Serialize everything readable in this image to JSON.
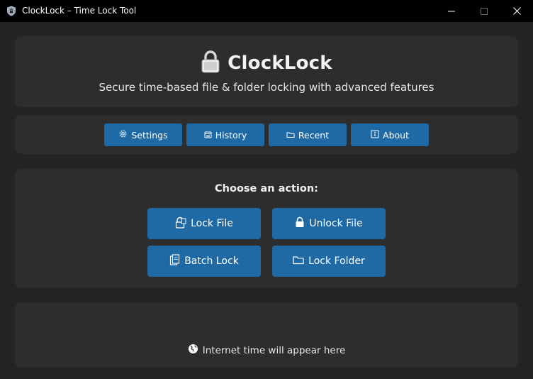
{
  "window": {
    "title": "ClockLock – Time Lock Tool",
    "icon": "shield-lock-icon"
  },
  "header": {
    "app_name": "ClockLock",
    "tagline": "Secure time-based file & folder locking with advanced features",
    "icon": "padlock-icon"
  },
  "nav": {
    "settings": {
      "label": "Settings",
      "icon": "gear-icon"
    },
    "history": {
      "label": "History",
      "icon": "history-icon"
    },
    "recent": {
      "label": "Recent",
      "icon": "folder-icon"
    },
    "about": {
      "label": "About",
      "icon": "info-icon"
    }
  },
  "actions": {
    "prompt": "Choose an action:",
    "lock_file": {
      "label": "Lock File",
      "icon": "lock-file-icon"
    },
    "unlock_file": {
      "label": "Unlock File",
      "icon": "unlock-icon"
    },
    "batch_lock": {
      "label": "Batch Lock",
      "icon": "batch-files-icon"
    },
    "lock_folder": {
      "label": "Lock Folder",
      "icon": "folder-icon"
    }
  },
  "time": {
    "status": "Internet time will appear here",
    "icon": "globe-icon"
  },
  "colors": {
    "background": "#242424",
    "panel": "#2d2d2d",
    "button": "#1f6aa5",
    "titlebar": "#000000"
  }
}
